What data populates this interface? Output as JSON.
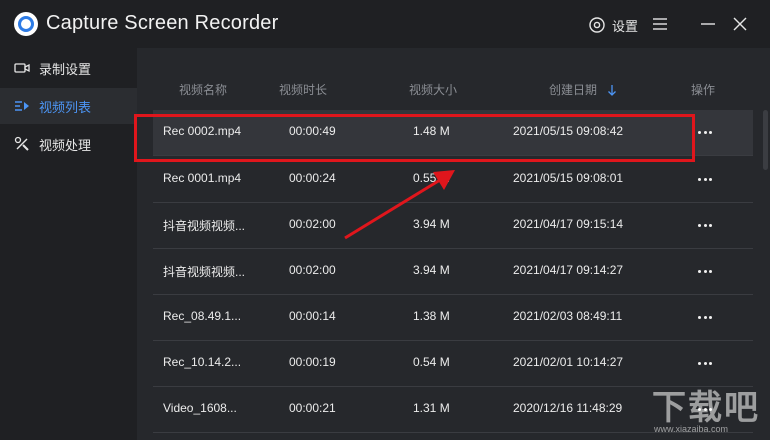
{
  "app": {
    "title": "Capture Screen Recorder",
    "settings_label": "设置"
  },
  "sidebar": {
    "items": [
      {
        "label": "录制设置",
        "icon": "camera-icon"
      },
      {
        "label": "视频列表",
        "icon": "list-icon",
        "active": true
      },
      {
        "label": "视频处理",
        "icon": "tools-icon"
      }
    ]
  },
  "table": {
    "headers": {
      "name": "视频名称",
      "duration": "视频时长",
      "size": "视频大小",
      "date": "创建日期",
      "actions": "操作"
    },
    "sort": {
      "column": "date",
      "direction": "descending"
    },
    "rows": [
      {
        "name": "Rec 0002.mp4",
        "duration": "00:00:49",
        "size": "1.48 M",
        "date": "2021/05/15 09:08:42",
        "selected": true
      },
      {
        "name": "Rec 0001.mp4",
        "duration": "00:00:24",
        "size": "0.55 M",
        "date": "2021/05/15 09:08:01"
      },
      {
        "name": "抖音视频视频...",
        "duration": "00:02:00",
        "size": "3.94 M",
        "date": "2021/04/17 09:15:14"
      },
      {
        "name": "抖音视频视频...",
        "duration": "00:02:00",
        "size": "3.94 M",
        "date": "2021/04/17 09:14:27"
      },
      {
        "name": "Rec_08.49.1...",
        "duration": "00:00:14",
        "size": "1.38 M",
        "date": "2021/02/03 08:49:11"
      },
      {
        "name": "Rec_10.14.2...",
        "duration": "00:00:19",
        "size": "0.54 M",
        "date": "2021/02/01 10:14:27"
      },
      {
        "name": "Video_1608...",
        "duration": "00:00:21",
        "size": "1.31 M",
        "date": "2020/12/16 11:48:29"
      }
    ]
  },
  "annotation": {
    "highlight_color": "#e0161c"
  },
  "watermark": {
    "text": "下载吧",
    "url": "www.xiazaiba.com"
  },
  "colors": {
    "accent": "#4c95f5",
    "titlebar_bg": "#1f2023",
    "content_bg": "#26282c"
  }
}
